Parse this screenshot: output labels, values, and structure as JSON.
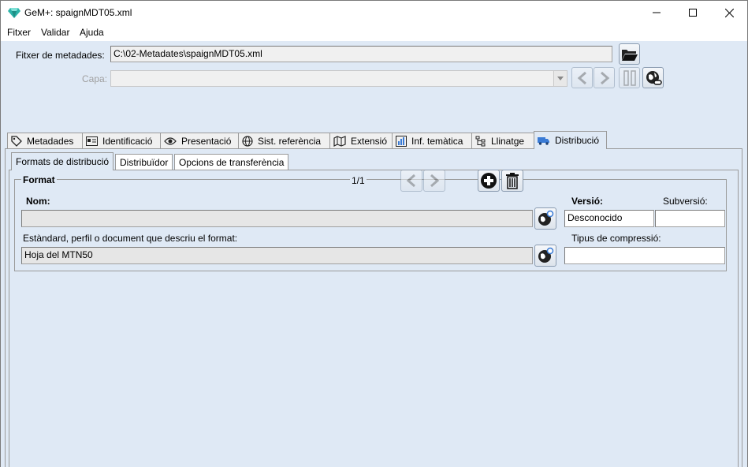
{
  "window": {
    "title": "GeM+: spaignMDT05.xml",
    "controls": [
      "minimize",
      "maximize",
      "close"
    ]
  },
  "menu": [
    "Fitxer",
    "Validar",
    "Ajuda"
  ],
  "metadata_file": {
    "label": "Fitxer de metadades:",
    "value": "C:\\02-Metadates\\spaignMDT05.xml"
  },
  "layer": {
    "label": "Capa:",
    "value": ""
  },
  "tabs": [
    {
      "label": "Metadades",
      "icon": "tag-icon"
    },
    {
      "label": "Identificació",
      "icon": "id-card-icon"
    },
    {
      "label": "Presentació",
      "icon": "eye-icon"
    },
    {
      "label": "Sist. referència",
      "icon": "globe-icon"
    },
    {
      "label": "Extensió",
      "icon": "map-icon"
    },
    {
      "label": "Inf. temàtica",
      "icon": "chart-icon"
    },
    {
      "label": "Llinatge",
      "icon": "tree-icon"
    },
    {
      "label": "Distribució",
      "icon": "truck-icon",
      "active": true
    }
  ],
  "subtabs": [
    {
      "label": "Formats de distribució",
      "active": true
    },
    {
      "label": "Distribuïdor"
    },
    {
      "label": "Opcions de transferència"
    }
  ],
  "format": {
    "group_title": "Format",
    "pager": "1/1",
    "name_label": "Nom:",
    "name_value": "",
    "version_label": "Versió:",
    "version_value": "Desconocido",
    "subversion_label": "Subversió:",
    "subversion_value": "",
    "standard_label": "Estàndard, perfil o document que descriu el format:",
    "standard_value": "Hoja del MTN50",
    "compression_label": "Tipus de compressió:",
    "compression_value": ""
  },
  "colors": {
    "client_bg": "#dfe9f5",
    "accent": "#3a7bd5"
  }
}
